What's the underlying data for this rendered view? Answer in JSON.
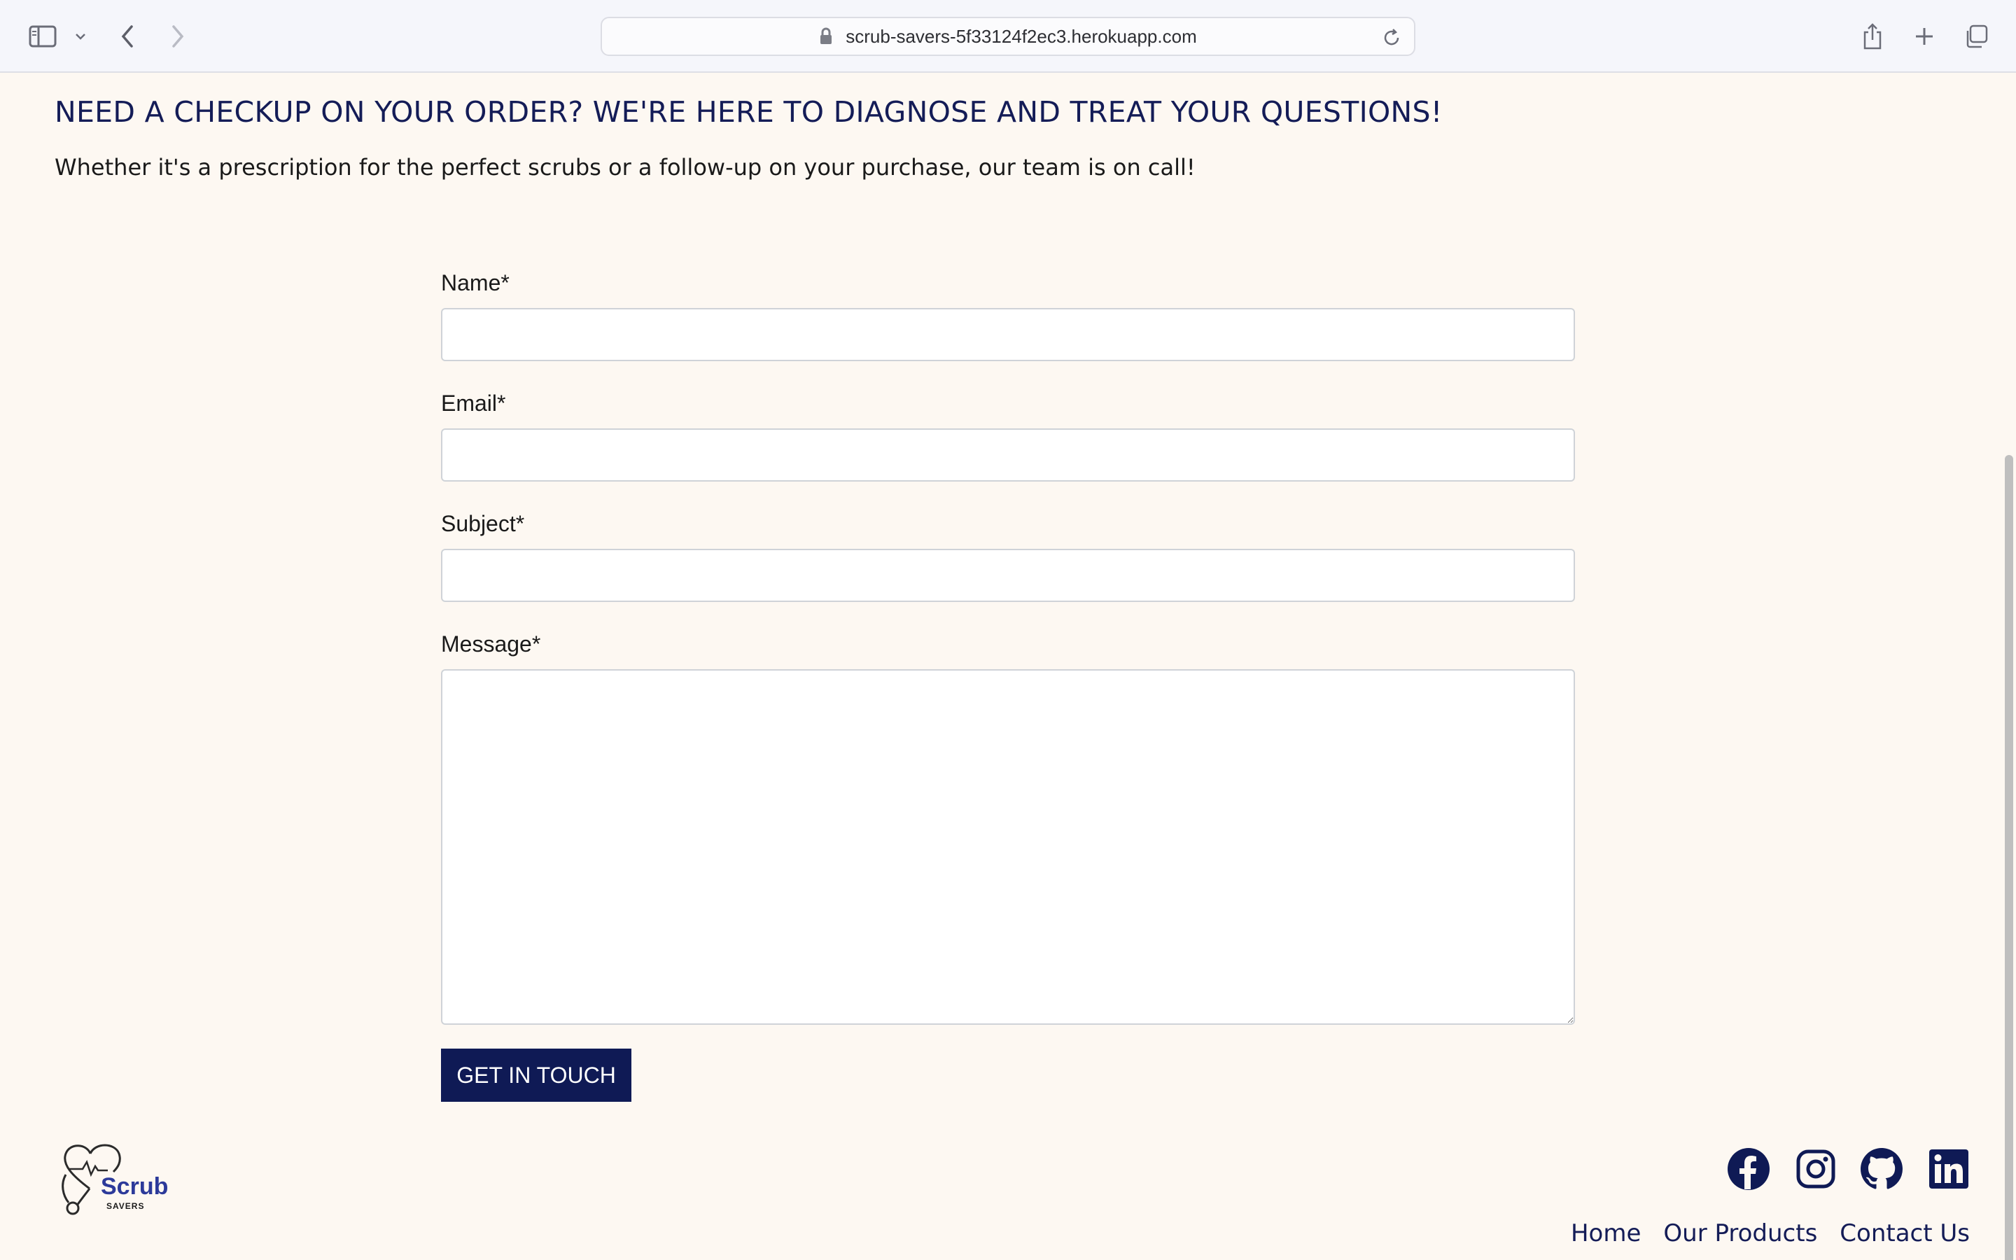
{
  "browser": {
    "url": "scrub-savers-5f33124f2ec3.herokuapp.com",
    "icons": [
      "sidebar-icon",
      "chevron-down-icon",
      "back-arrow-icon",
      "forward-arrow-icon",
      "lock-icon",
      "reload-icon",
      "share-icon",
      "plus-icon",
      "tabs-icon"
    ]
  },
  "page": {
    "heading": "NEED A CHECKUP ON YOUR ORDER? WE'RE HERE TO DIAGNOSE AND TREAT YOUR QUESTIONS!",
    "subtext": "Whether it's a prescription for the perfect scrubs or a follow-up on your purchase, our team is on call!"
  },
  "form": {
    "name_label": "Name*",
    "name_value": "",
    "email_label": "Email*",
    "email_value": "",
    "subject_label": "Subject*",
    "subject_value": "",
    "message_label": "Message*",
    "message_value": "",
    "submit_label": "GET IN TOUCH"
  },
  "footer": {
    "logo_text": "Scrub",
    "logo_subtext": "SAVERS",
    "social": [
      "facebook-icon",
      "instagram-icon",
      "github-icon",
      "linkedin-icon"
    ],
    "nav": [
      "Home",
      "Our Products",
      "Contact Us"
    ]
  },
  "colors": {
    "page_bg": "#fdf8f2",
    "primary": "#0f1a55",
    "heading": "#141c57",
    "input_border": "#cfd3d8"
  }
}
